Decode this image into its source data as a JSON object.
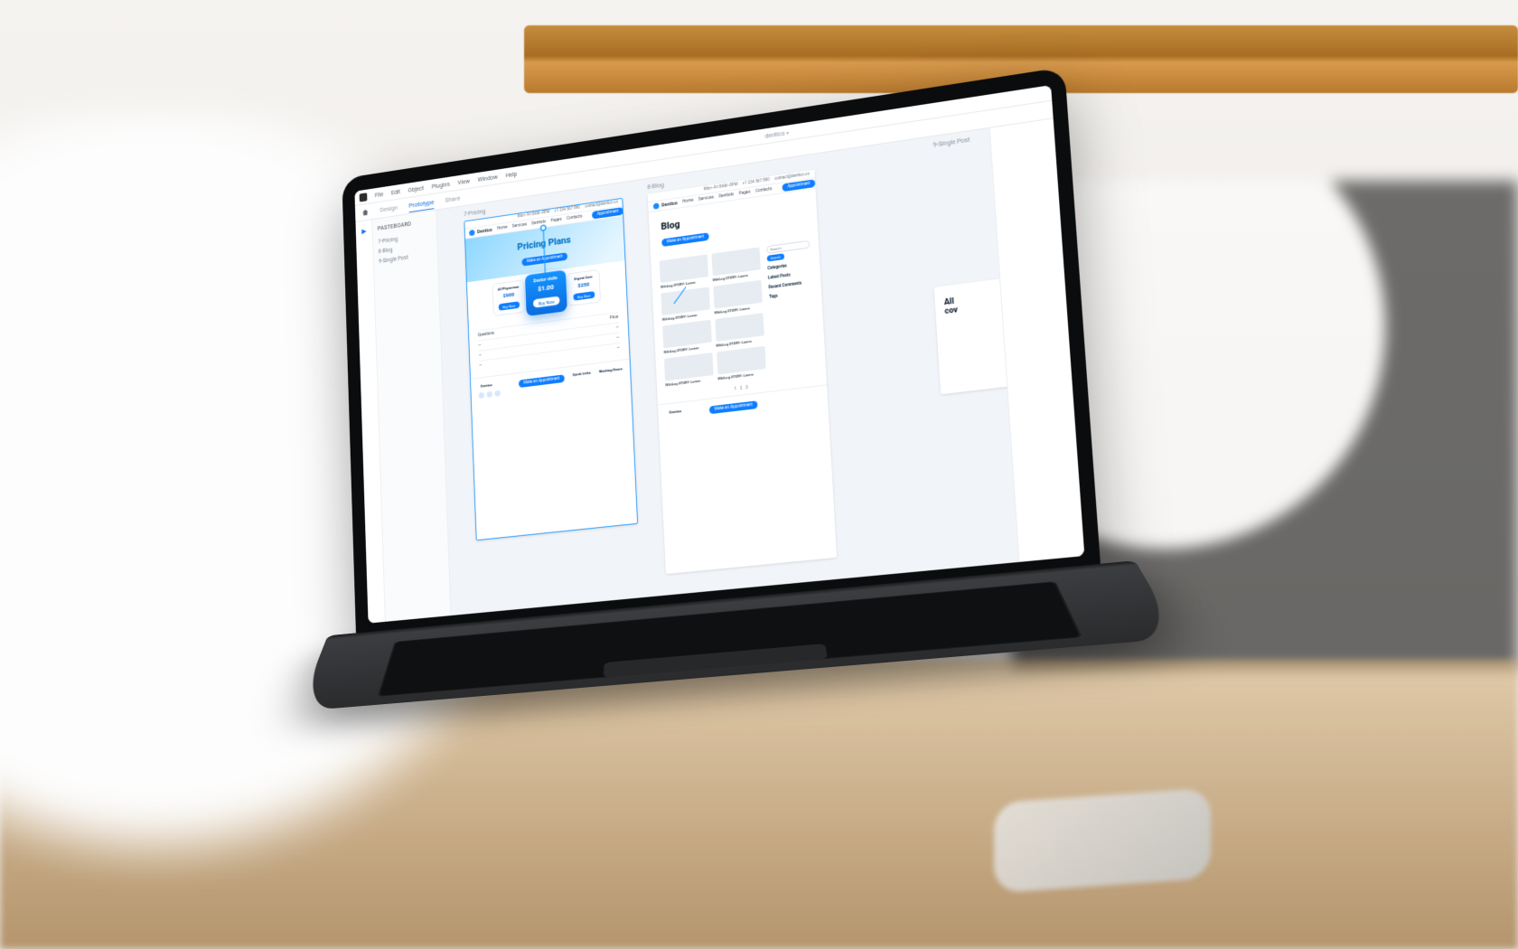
{
  "menubar": {
    "items": [
      "File",
      "Edit",
      "Object",
      "Plugins",
      "View",
      "Window",
      "Help"
    ],
    "doc_title": "dentico"
  },
  "toolbar": {
    "modes": {
      "design": "Design",
      "prototype": "Prototype",
      "share": "Share"
    }
  },
  "tools": {
    "play_tooltip": "Desktop Preview"
  },
  "layers": {
    "header": "Pasteboard"
  },
  "artboard_pricing": {
    "label": "7-Pricing",
    "top_bar": {
      "hours": "Mon–Fri 8AM–8PM",
      "phone": "+1 234 567 890",
      "email": "contact@dentico.co"
    },
    "brand": "Dentico",
    "nav_items": [
      "Home",
      "Services",
      "Dentists",
      "Pages",
      "Contacts"
    ],
    "cta": "Appointment",
    "hero_title": "Pricing Plans",
    "hero_btn": "Make an Appointment",
    "plans": [
      {
        "name": "All Physicians",
        "price": "$900"
      },
      {
        "name": "Doctor visits",
        "price": "$1.00"
      },
      {
        "name": "Urgent Care",
        "price": "$250"
      }
    ],
    "plan_btn": "Buy Now",
    "faq_header": "Questions",
    "faq_price_hdr": "Price"
  },
  "artboard_blog": {
    "label": "8-Blog",
    "brand": "Dentico",
    "nav_items": [
      "Home",
      "Services",
      "Dentists",
      "Pages",
      "Contacts"
    ],
    "cta": "Appointment",
    "hero_title": "Blog",
    "hero_btn": "Make an Appointment",
    "post_title": "WikiLog STORY: Lorem",
    "sidebar": {
      "search_ph": "Search",
      "categories_hd": "Categories",
      "latest_hd": "Latest Posts",
      "comments_hd": "Recent Comments",
      "tags_hd": "Tags"
    },
    "pager": [
      "1",
      "2",
      "3"
    ]
  },
  "artboard_single": {
    "label": "9-Single Post",
    "headline": "All\ncov"
  },
  "footer": {
    "brand": "Dentico",
    "newsletter_btn": "Make an Appointment",
    "cols": {
      "quick_hd": "Quick Links",
      "hours_hd": "Working Hours"
    }
  }
}
